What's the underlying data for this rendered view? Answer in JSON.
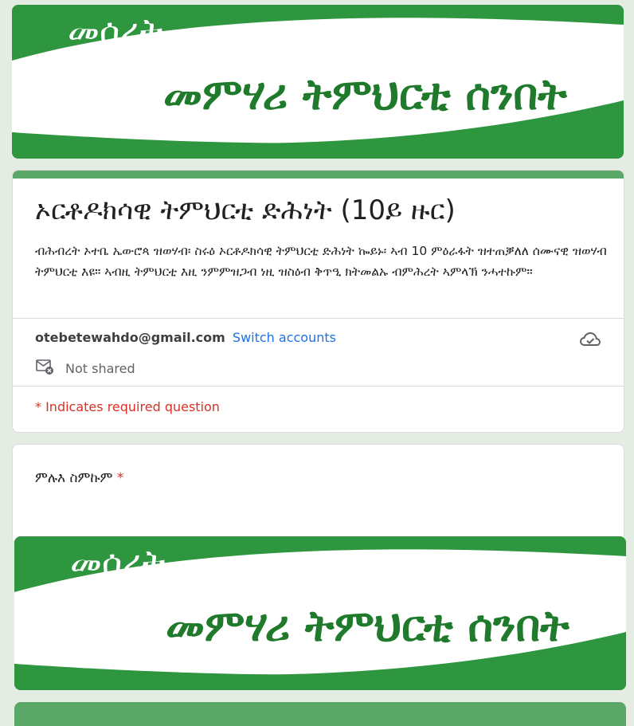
{
  "banner": {
    "small_text": "መሰረት",
    "big_text": "መምሃሪ ትምህርቲ ሰንበት",
    "colors": {
      "green": "#2f9640",
      "white": "#ffffff",
      "text_green": "#1f7a2c"
    }
  },
  "form": {
    "title": "ኦርቶዶክሳዊ ትምህርቲ ድሕነት (10ይ ዙር)",
    "description": "ብሕብረት ኦተቤ ኤውሮጳ ዝወሃብ፡ ስሩዕ ኦርቶዶክሳዊ ትምህርቲ ድሕነት ኰይኑ፡ ኣብ 10 ምዕራፋት ዝተጠቓለለ ሰሙናዊ ዝወሃብ ትምህርቲ እዩ። ኣብዚ ትምህርቲ እዚ ንምምዝጋብ ነዚ ዝስዕብ ቅጥዒ ክትመልኡ ብምሕረት ኣምላኽ ንሓተኩም።",
    "account_email": "otebetewahdo@gmail.com",
    "switch_accounts": "Switch accounts",
    "not_shared": "Not shared",
    "required_note": "* Indicates required question"
  },
  "question": {
    "label": "ምሉእ ስምኩም",
    "required_mark": "*"
  },
  "icons": {
    "cloud": "cloud-check-icon",
    "mail": "mail-not-shared-icon"
  },
  "colors": {
    "accent": "#5aa768",
    "link": "#1a73e8",
    "required": "#d93025",
    "background": "#e4ece4"
  }
}
